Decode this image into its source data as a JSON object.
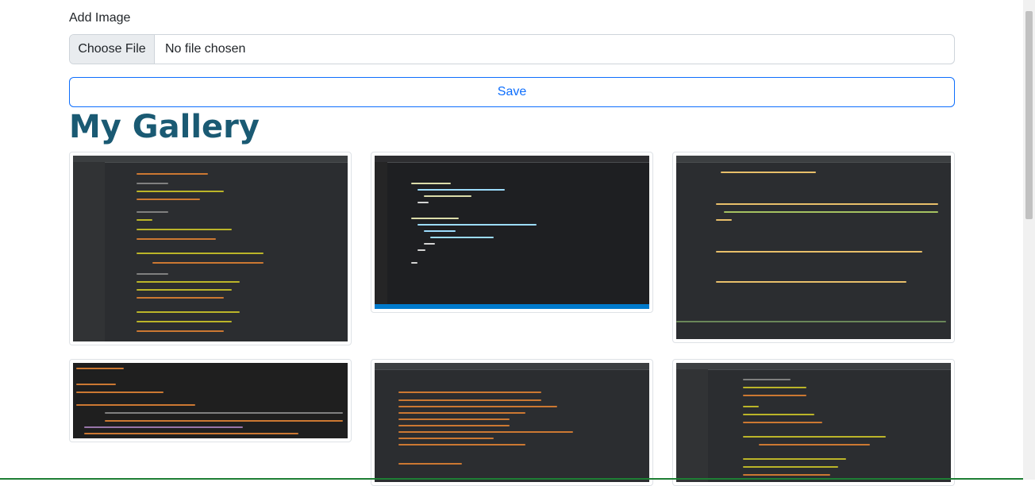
{
  "form": {
    "image_label": "Add Image",
    "file_button_label": "Choose File",
    "file_status": "No file chosen",
    "save_label": "Save"
  },
  "gallery": {
    "title": "My Gallery",
    "items": [
      {
        "alt": "gallery image 1"
      },
      {
        "alt": "gallery image 2"
      },
      {
        "alt": "gallery image 3"
      },
      {
        "alt": "gallery image 4"
      },
      {
        "alt": "gallery image 5"
      },
      {
        "alt": "gallery image 6"
      }
    ]
  },
  "colors": {
    "accent": "#0d6efd",
    "title": "#1a5a73"
  }
}
